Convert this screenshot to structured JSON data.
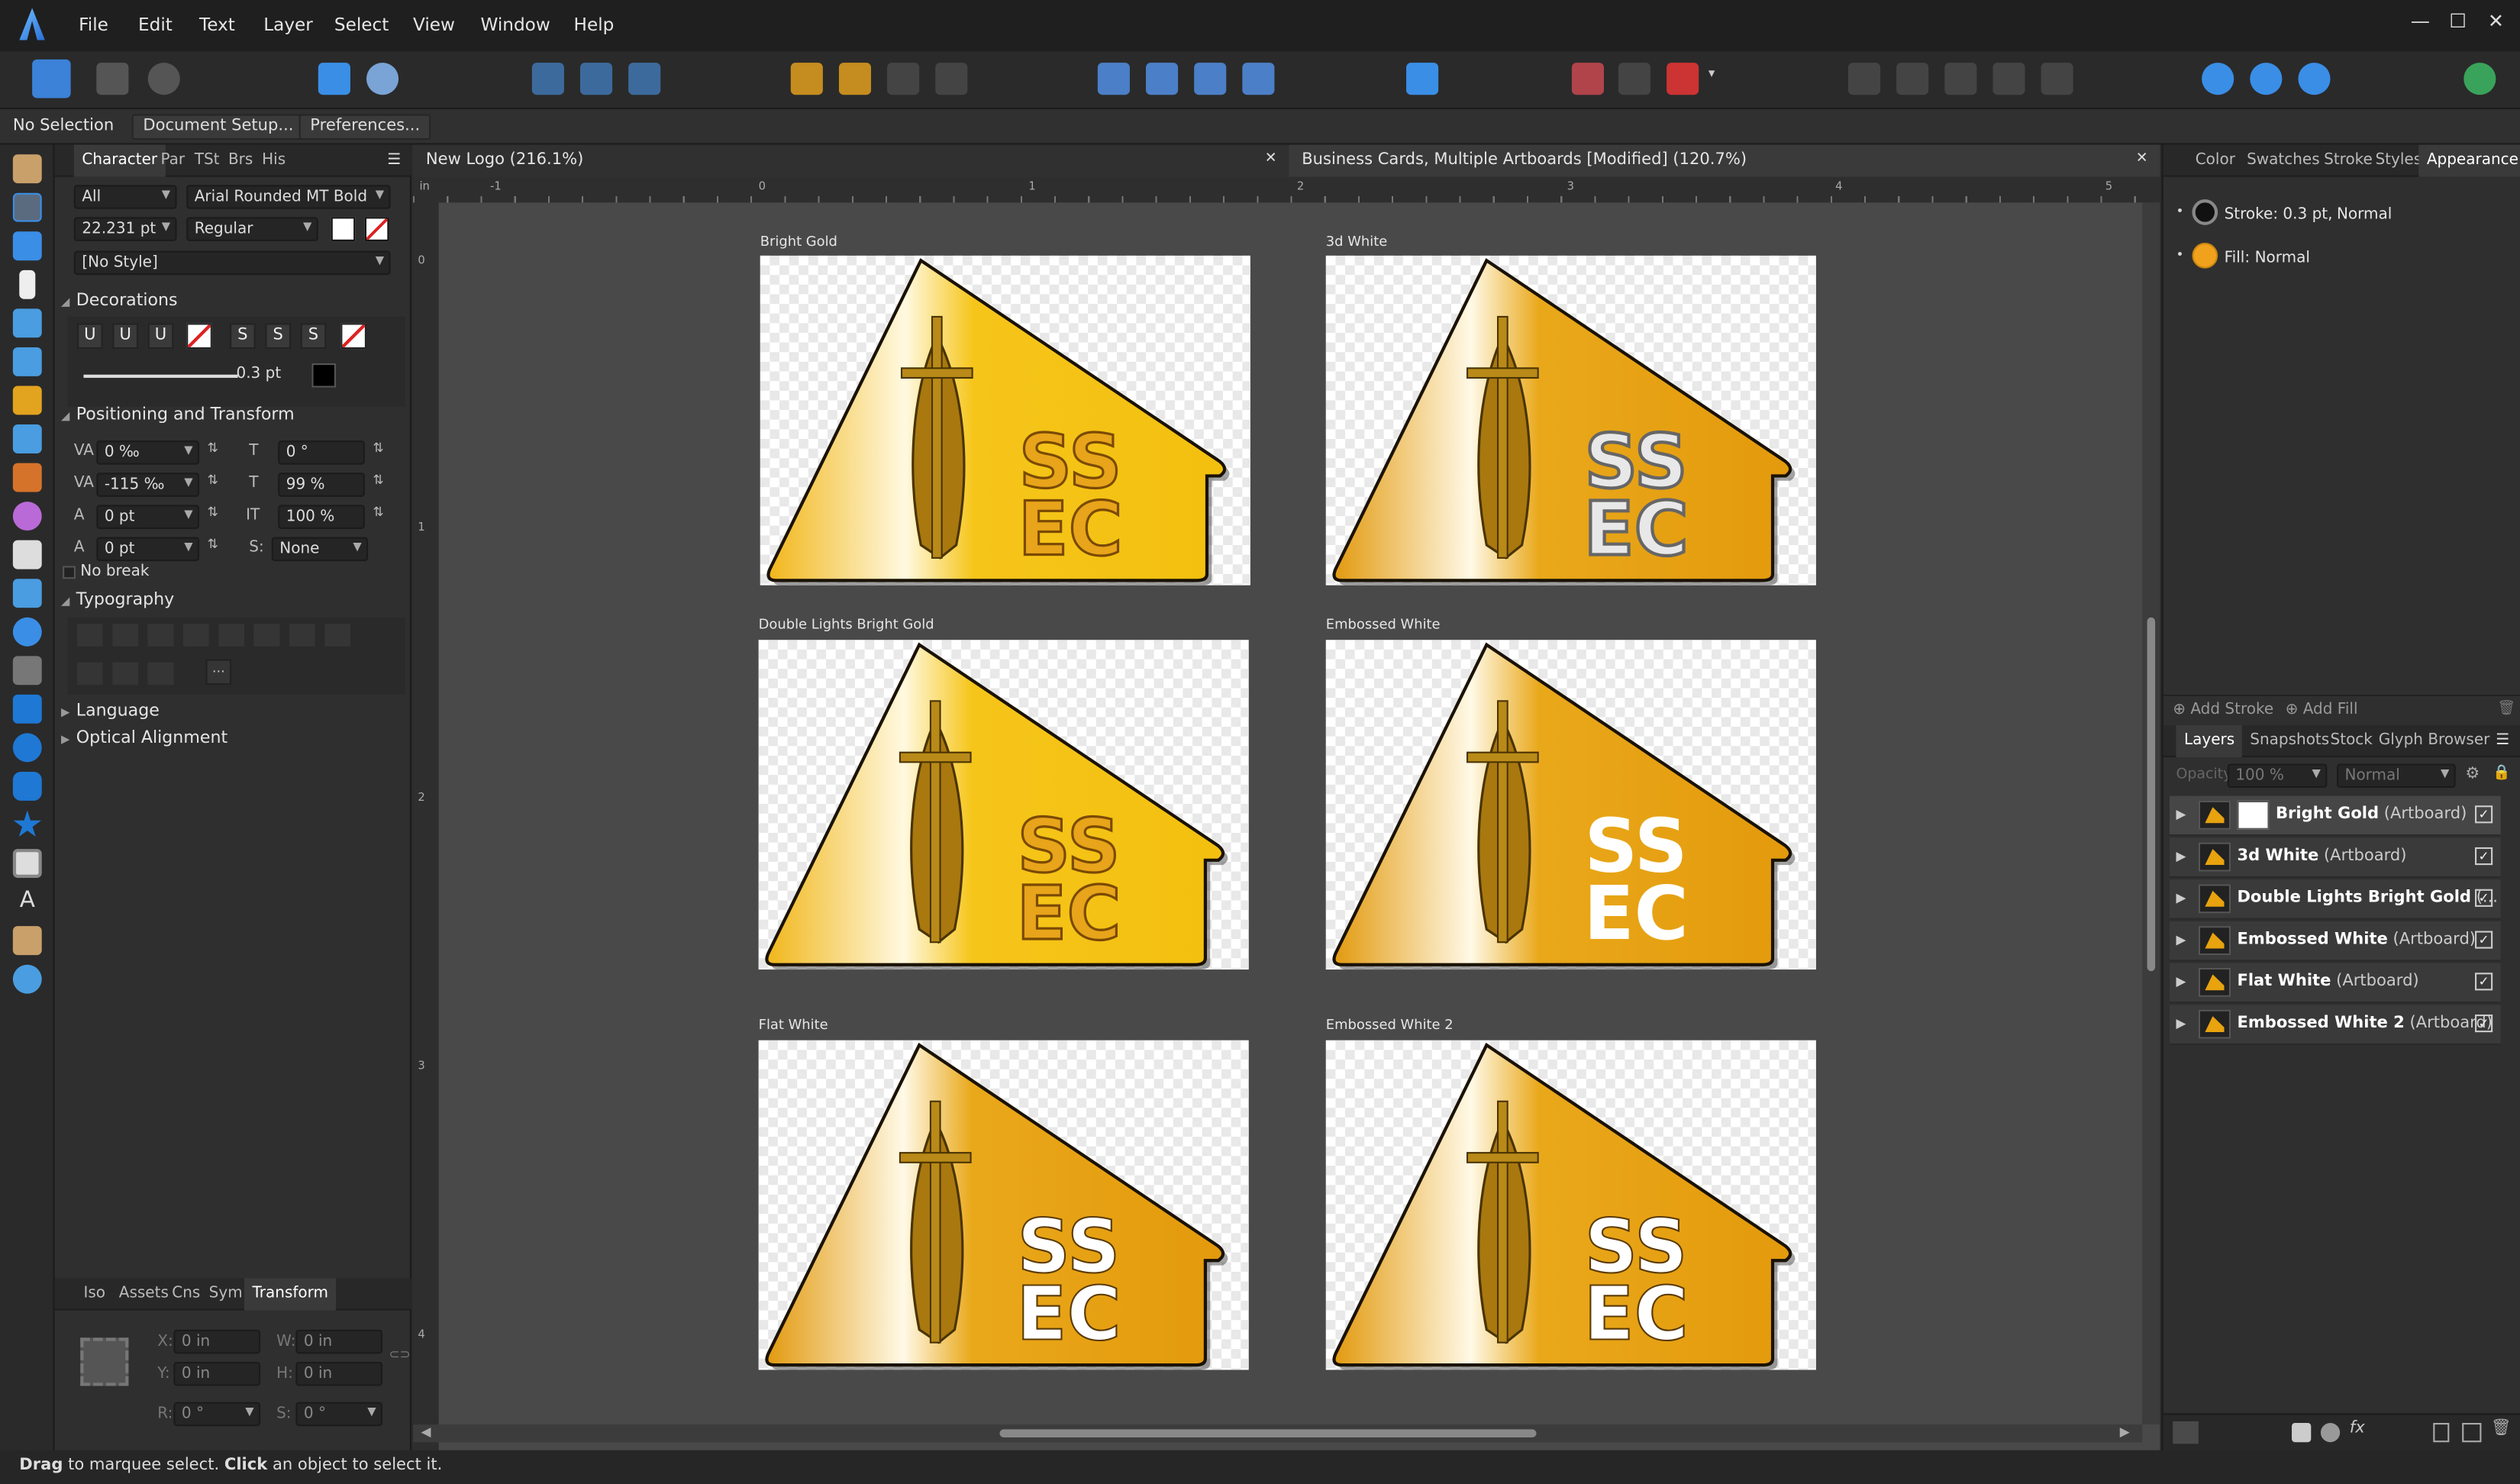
{
  "menu": [
    "File",
    "Edit",
    "Text",
    "Layer",
    "Select",
    "View",
    "Window",
    "Help"
  ],
  "window_controls": {
    "minimize": "—",
    "maximize": "☐",
    "close": "✕"
  },
  "context_bar": {
    "selection": "No Selection",
    "doc_setup": "Document Setup...",
    "preferences": "Preferences..."
  },
  "character_panel": {
    "tabs": [
      "Character",
      "Par",
      "TSt",
      "Brs",
      "His"
    ],
    "scope": "All",
    "font": "Arial Rounded MT Bold",
    "size": "22.231 pt",
    "weight": "Regular",
    "style": "[No Style]",
    "decorations_title": "Decorations",
    "underline_weight": "0.3 pt",
    "positioning_title": "Positioning and Transform",
    "tracking": "0 ‰",
    "kerning": "-115 ‰",
    "baseline": "0 pt",
    "leading_field": "0 pt",
    "skew": "0 °",
    "height_scale": "99 %",
    "width_scale": "100 %",
    "case": "None",
    "no_break": "No break",
    "typography_title": "Typography",
    "language_title": "Language",
    "optical_title": "Optical Alignment"
  },
  "transform_panel": {
    "tabs": [
      "Iso",
      "Assets",
      "Cns",
      "Sym",
      "Transform"
    ],
    "x": "0 in",
    "y": "0 in",
    "w": "0 in",
    "h": "0 in",
    "r": "0 °",
    "s": "0 °",
    "labels": {
      "x": "X:",
      "y": "Y:",
      "w": "W:",
      "h": "H:",
      "r": "R:",
      "s": "S:"
    }
  },
  "documents": [
    {
      "title": "New Logo (216.1%)",
      "close": "✕"
    },
    {
      "title": "Business Cards, Multiple Artboards [Modified] (120.7%)",
      "close": "✕"
    }
  ],
  "ruler": {
    "unit": "in",
    "ticks": [
      "-1",
      "0",
      "1",
      "2",
      "3",
      "4",
      "5"
    ],
    "vticks": [
      "0",
      "1",
      "2",
      "3",
      "4"
    ]
  },
  "artboards": [
    {
      "label": "Bright Gold",
      "text_top": "SS",
      "text_bottom": "EC",
      "variant": "gold"
    },
    {
      "label": "3d White",
      "text_top": "SS",
      "text_bottom": "EC",
      "variant": "silver"
    },
    {
      "label": "Double Lights Bright Gold",
      "text_top": "SS",
      "text_bottom": "EC",
      "variant": "gold"
    },
    {
      "label": "Embossed White",
      "text_top": "SS",
      "text_bottom": "EC",
      "variant": "white"
    },
    {
      "label": "Flat White",
      "text_top": "SS",
      "text_bottom": "EC",
      "variant": "white-outline"
    },
    {
      "label": "Embossed White 2",
      "text_top": "SS",
      "text_bottom": "EC",
      "variant": "white-outline"
    }
  ],
  "appearance_panel": {
    "tabs": [
      "Color",
      "Swatches",
      "Stroke",
      "Styles",
      "Appearance"
    ],
    "stroke": "Stroke: 0.3 pt,",
    "stroke_mode": "Normal",
    "fill": "Fill:",
    "fill_mode": "Normal",
    "add_stroke": "Add Stroke",
    "add_fill": "Add Fill"
  },
  "layers_panel": {
    "tabs": [
      "Layers",
      "Snapshots",
      "Stock",
      "Glyph Browser"
    ],
    "opacity_label": "Opacity:",
    "opacity": "100 %",
    "blend": "Normal",
    "layers": [
      {
        "name": "Bright Gold",
        "type": "(Artboard)"
      },
      {
        "name": "3d White",
        "type": "(Artboard)"
      },
      {
        "name": "Double Lights Bright Gold",
        "type": "(..."
      },
      {
        "name": "Embossed White",
        "type": "(Artboard)"
      },
      {
        "name": "Flat White",
        "type": "(Artboard)"
      },
      {
        "name": "Embossed White 2",
        "type": "(Artboard)"
      }
    ]
  },
  "status": {
    "drag": "Drag",
    "mid": " to marquee select. ",
    "click": "Click",
    "end": " an object to select it."
  },
  "colors": {
    "accent": "#3a8ee6",
    "gold": "#e8a10f",
    "gold_light": "#f7c619",
    "panel": "#2f2f2f"
  }
}
